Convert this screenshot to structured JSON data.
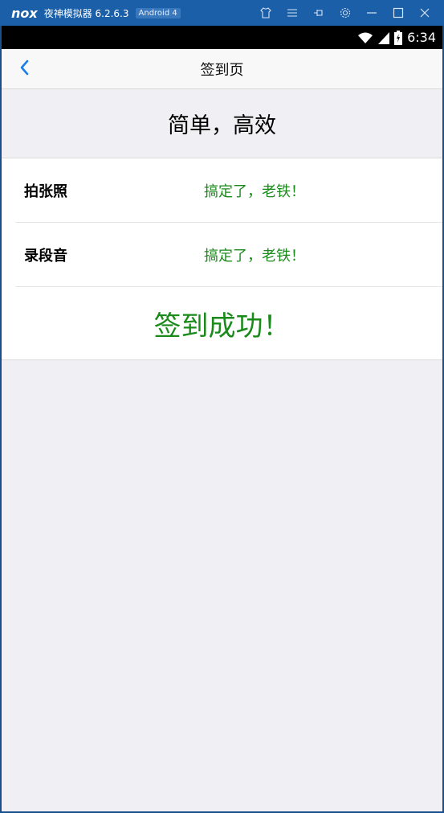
{
  "emulator": {
    "logo": "nox",
    "title": "夜神模拟器 6.2.6.3",
    "badge": "Android 4",
    "controls": [
      "shirt-icon",
      "menu-icon",
      "pin-icon",
      "gear-icon",
      "minimize-icon",
      "maximize-icon",
      "close-icon"
    ]
  },
  "status_bar": {
    "time": "6:34",
    "icons": [
      "wifi-icon",
      "signal-icon",
      "battery-icon"
    ]
  },
  "nav": {
    "title": "签到页"
  },
  "banner": {
    "text": "简单，高效"
  },
  "rows": [
    {
      "label": "拍张照",
      "value": "搞定了，老铁！"
    },
    {
      "label": "录段音",
      "value": "搞定了，老铁！"
    }
  ],
  "result": {
    "text": "签到成功！"
  },
  "colors": {
    "success_green": "#1a8a1a",
    "accent_blue": "#1a7ee6",
    "emulator_blue": "#1b5fa8"
  }
}
